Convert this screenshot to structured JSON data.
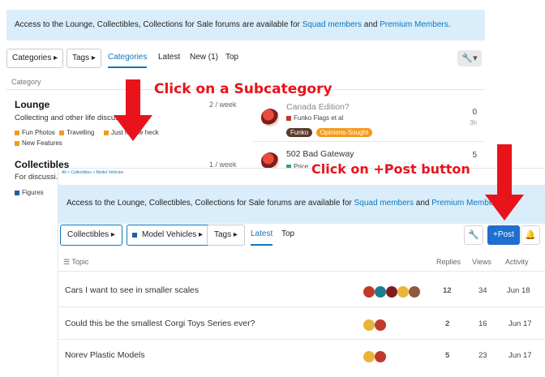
{
  "back": {
    "banner": {
      "prefix": "Access to the Lounge, Collectibles, Collections for Sale forums are available for ",
      "link1": "Squad members",
      "mid": " and ",
      "link2": "Premium Members",
      "suffix": "."
    },
    "nav": {
      "categories": "Categories ▸",
      "tags": "Tags ▸",
      "tab_categories": "Categories",
      "tab_latest": "Latest",
      "tab_new": "New (1)",
      "tab_top": "Top"
    },
    "category_header": "Category",
    "categories": [
      {
        "name": "Lounge",
        "desc": "Collecting and other life discus...",
        "week": "2 / week",
        "subs": [
          "Fun Photos",
          "Travelling",
          "Just for the heck",
          "New Features"
        ]
      },
      {
        "name": "Collectibles",
        "desc": "For discussi...",
        "week": "1 / week",
        "subs": [
          "Figures"
        ]
      }
    ],
    "topics": [
      {
        "title": "Canada Edition?",
        "meta": "Funko Flags et al",
        "tags": [
          "Funko",
          "Opinions-Sought"
        ],
        "replies": "0",
        "age": "3h"
      },
      {
        "title": "502 Bad Gateway",
        "meta": "Price",
        "replies": "5"
      }
    ]
  },
  "front": {
    "breadcrumb": "All > Collectibles > Model Vehicles",
    "banner": {
      "prefix": "Access to the Lounge, Collectibles, Collections for Sale forums are available for ",
      "link1": "Squad members",
      "mid": " and ",
      "link2": "Premium Membe"
    },
    "nav": {
      "collectibles": "Collectibles ▸",
      "model_vehicles": "Model Vehicles ▸",
      "tags": "Tags ▸",
      "tab_latest": "Latest",
      "tab_top": "Top",
      "post_button": "+Post"
    },
    "columns": {
      "topic": "Topic",
      "replies": "Replies",
      "views": "Views",
      "activity": "Activity"
    },
    "rows": [
      {
        "title": "Cars I want to see in smaller scales",
        "replies": "12",
        "views": "34",
        "activity": "Jun 18"
      },
      {
        "title": "Could this be the smallest Corgi Toys Series ever?",
        "replies": "2",
        "views": "16",
        "activity": "Jun 17"
      },
      {
        "title": "Norev Plastic Models",
        "replies": "5",
        "views": "23",
        "activity": "Jun 17"
      }
    ]
  },
  "annotations": {
    "subcategory": "Click on a Subcategory",
    "post": "Click on +Post button"
  },
  "colors": {
    "accent": "#0e76bd",
    "annotation": "#e8131b",
    "banner": "#d9eefa",
    "post_button": "#1e6fd0",
    "subcategory_orange": "#f39b1c",
    "subcategory_blue": "#1e5faa"
  },
  "icons": {
    "wrench": "wrench-icon",
    "bell": "bell-icon",
    "list": "list-icon",
    "arrow": "down-arrow-annotation"
  }
}
